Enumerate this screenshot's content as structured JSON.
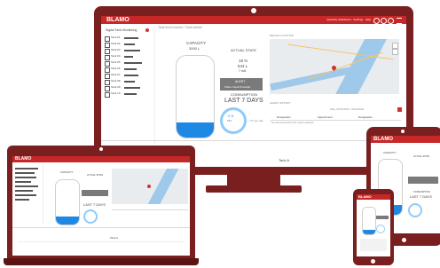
{
  "brand": {
    "logo": "BLAMO"
  },
  "monitor": {
    "breadcrumb": "Tank level monitor  /  Tank details",
    "header_actions": "Quarterly dashboard  ·  Settings  ·  Help",
    "sidebar_title": "Digital Tank Monitoring",
    "sidebar_items": [
      {
        "label": "Tank 01"
      },
      {
        "label": "Tank 02"
      },
      {
        "label": "Tank 03"
      },
      {
        "label": "Tank 04"
      },
      {
        "label": "Tank 05"
      },
      {
        "label": "Tank 06"
      },
      {
        "label": "Tank 07"
      },
      {
        "label": "Tank 08"
      },
      {
        "label": "Tank 09"
      },
      {
        "label": "Tank 10"
      }
    ],
    "capacity_label": "CAPACITY",
    "capacity_value": "3000 L",
    "actual_state_label": "ACTUAL STATE",
    "actual_percent": "18 %",
    "actual_litres": "544 L",
    "actual_time": "7 mA",
    "alert_title": "ALERT",
    "alert_text": "Table in liquid threshold",
    "consumption_label": "CONSUMPTION",
    "consumption_period": "LAST 7 DAYS",
    "ring_percent": "-3 %",
    "ring_sub": "74 L",
    "small_stats": "+ 7%  per day",
    "device_location_label": "DEVICE LOCATION",
    "alert_history_label": "ALERT HISTORY",
    "date_range": "Date: 01/01/2020 - 31/12/2020",
    "table_headers": [
      "Designation",
      "Appointment",
      "Designation"
    ],
    "table_empty": "No records found for the current selection",
    "chart_title": "Tank A",
    "fill_level": 0.18
  },
  "tablet": {
    "logo": "BLAMO"
  },
  "laptop": {
    "logo": "BLAMO",
    "chart_title": "Tank A"
  },
  "phone": {
    "logo": "BLAMO"
  }
}
